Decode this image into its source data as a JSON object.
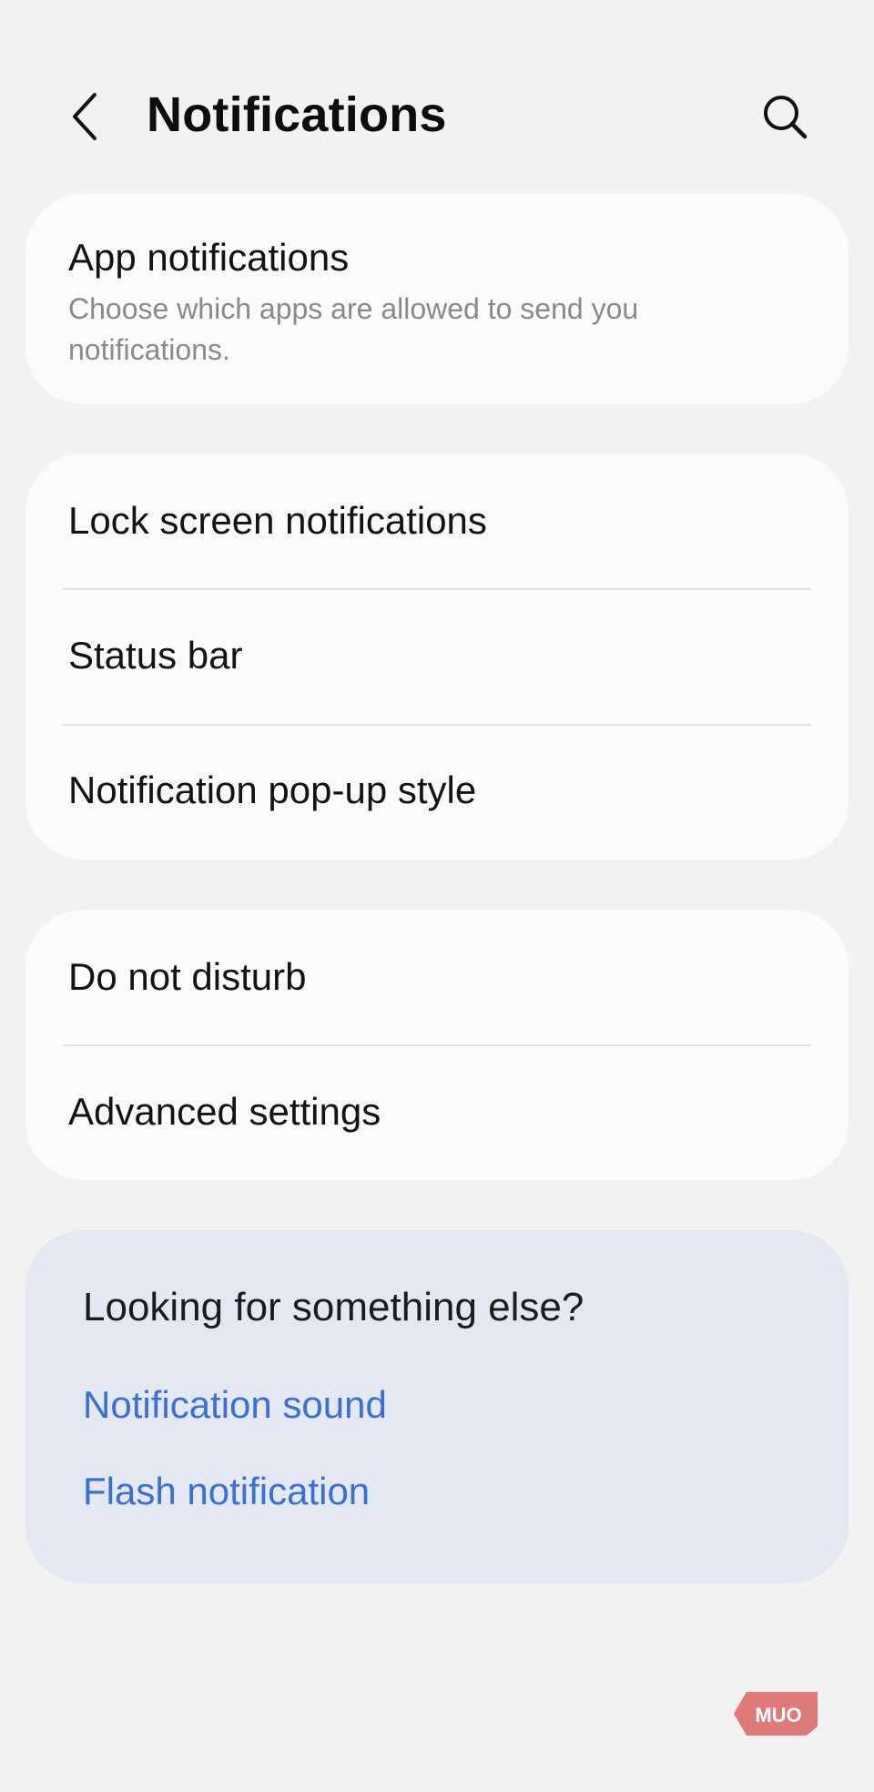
{
  "header": {
    "title": "Notifications",
    "back_icon": "chevron-left-icon",
    "search_icon": "search-icon"
  },
  "app_notifications": {
    "title": "App notifications",
    "description": "Choose which apps are allowed to send you notifications."
  },
  "group2": {
    "items": [
      {
        "label": "Lock screen notifications"
      },
      {
        "label": "Status bar"
      },
      {
        "label": "Notification pop-up style"
      }
    ]
  },
  "group3": {
    "items": [
      {
        "label": "Do not disturb"
      },
      {
        "label": "Advanced settings"
      }
    ]
  },
  "suggestions": {
    "title": "Looking for something else?",
    "links": [
      {
        "label": "Notification sound"
      },
      {
        "label": "Flash notification"
      }
    ],
    "link_color": "#3a6fd4"
  },
  "watermark": {
    "text": "MUO",
    "color": "#e07a79"
  }
}
